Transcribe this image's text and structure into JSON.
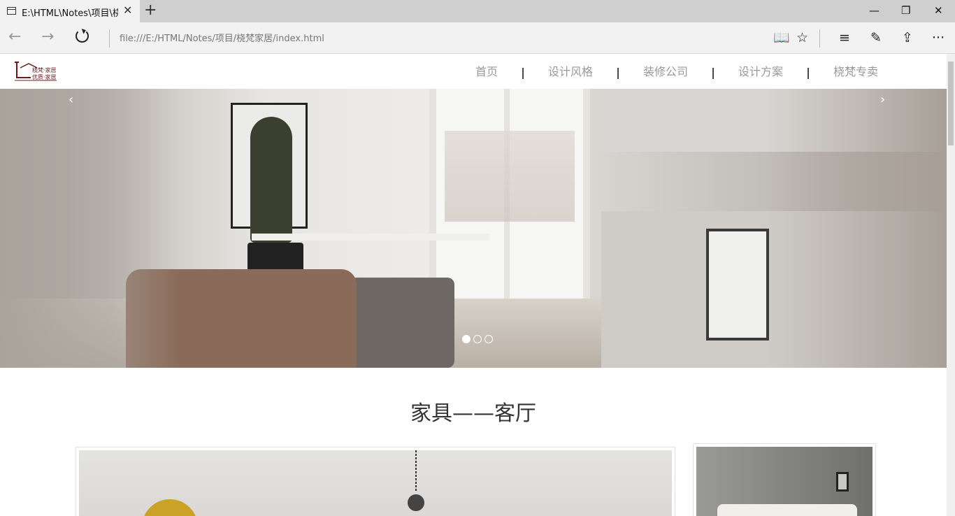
{
  "browser": {
    "tab_title": "E:\\HTML\\Notes\\项目\\桡",
    "tab_close": "✕",
    "new_tab": "+",
    "minimize": "—",
    "restore": "❐",
    "close": "✕",
    "back": "←",
    "forward": "→",
    "address": "file:///E:/HTML/Notes/项目/桡梵家居/index.html",
    "reading_view": "📖",
    "favorite": "☆",
    "hub": "≡",
    "web_note": "✎",
    "share": "⇪",
    "more": "···"
  },
  "site": {
    "logo_main": "桡梵·家居",
    "logo_sub": "优质·家居",
    "nav": [
      "首页",
      "设计风格",
      "装修公司",
      "设计方案",
      "桡梵专卖"
    ],
    "nav_separator": "|"
  },
  "hero": {
    "prev": "‹",
    "next": "›",
    "slide_count": 3,
    "active_slide": 1
  },
  "section": {
    "title": "家具——客厅"
  }
}
